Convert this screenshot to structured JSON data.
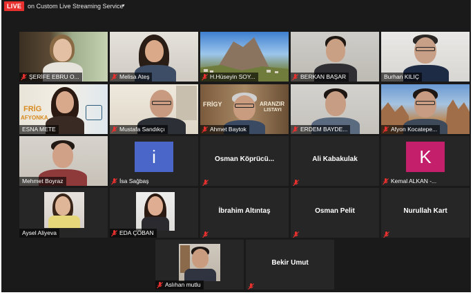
{
  "topbar": {
    "live_label": "LIVE",
    "stream_label": "on Custom Live Streaming Service",
    "caret": "▾"
  },
  "colors": {
    "live_red": "#e8302e",
    "tile_bg": "#262626",
    "active_speaker": "#e0d35b",
    "muted_mic": "#e8302e",
    "avatar_blue": "#4a66c8",
    "avatar_pink": "#c41f6a"
  },
  "participants": [
    {
      "name": "ŞERİFE EBRU O...",
      "video": true,
      "muted": true
    },
    {
      "name": "Melisa Ateş",
      "video": true,
      "muted": true
    },
    {
      "name": "H.Hüseyin SOY...",
      "video": true,
      "muted": true
    },
    {
      "name": "BERKAN BAŞAR",
      "video": true,
      "muted": true
    },
    {
      "name": "Burhan KILIÇ",
      "video": true,
      "muted": false
    },
    {
      "name": "ESNA METE",
      "video": true,
      "muted": false,
      "active": true
    },
    {
      "name": "Mustafa Sandıkçı",
      "video": true,
      "muted": true
    },
    {
      "name": "Ahmet Baytok",
      "video": true,
      "muted": true
    },
    {
      "name": "ERDEM BAYDE...",
      "video": true,
      "muted": true
    },
    {
      "name": "Afyon Kocatepe...",
      "video": true,
      "muted": true
    },
    {
      "name": "Mehmet Boyraz",
      "video": true,
      "muted": false
    },
    {
      "name": "İsa Sağbaş",
      "video": false,
      "muted": true,
      "avatar_letter": "i",
      "avatar_color": "#4a66c8"
    },
    {
      "name": "Osman  Köprücü...",
      "video": false,
      "muted": true
    },
    {
      "name": "Ali Kabakulak",
      "video": false,
      "muted": true
    },
    {
      "name": "Kemal ALKAN -...",
      "video": false,
      "muted": true,
      "avatar_letter": "K",
      "avatar_color": "#c41f6a"
    },
    {
      "name": "Aysel Aliyeva",
      "video": true,
      "muted": false
    },
    {
      "name": "EDA ÇOBAN",
      "video": true,
      "muted": true
    },
    {
      "name": "İbrahim Altıntaş",
      "video": false,
      "muted": true
    },
    {
      "name": "Osman Pelit",
      "video": false,
      "muted": true
    },
    {
      "name": "Nurullah Kart",
      "video": false,
      "muted": true
    },
    {
      "name": "Aslıhan mutlu",
      "video": true,
      "muted": true
    },
    {
      "name": "Bekir Umut",
      "video": false,
      "muted": true
    }
  ],
  "slide_texts": {
    "esna_left": "FRİG",
    "esna_left2": "AFYONKA",
    "ahmet_left": "FRİGY",
    "ahmet_right": "ARANZIR",
    "ahmet_right2": "LISTAYI"
  }
}
